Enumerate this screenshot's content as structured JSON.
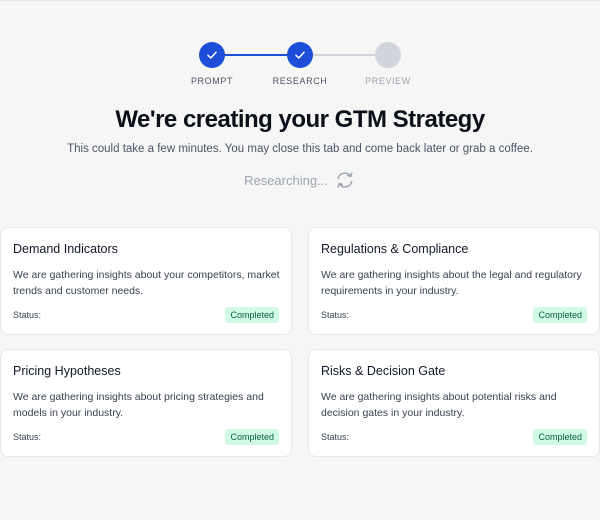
{
  "stepper": {
    "steps": [
      {
        "label": "PROMPT",
        "state": "completed"
      },
      {
        "label": "RESEARCH",
        "state": "completed"
      },
      {
        "label": "PREVIEW",
        "state": "pending"
      }
    ]
  },
  "header": {
    "title": "We're creating your GTM Strategy",
    "subtitle": "This could take a few minutes. You may close this tab and come back later or grab a coffee.",
    "status_text": "Researching...",
    "status_icon": "refresh-icon"
  },
  "cards": [
    {
      "title": "Demand Indicators",
      "description": "We are gathering insights about your competitors, market trends and customer needs.",
      "status_label": "Status:",
      "status_badge": "Completed"
    },
    {
      "title": "Regulations & Compliance",
      "description": "We are gathering insights about the legal and regulatory requirements in your industry.",
      "status_label": "Status:",
      "status_badge": "Completed"
    },
    {
      "title": "Pricing Hypotheses",
      "description": "We are gathering insights about pricing strategies and models in your industry.",
      "status_label": "Status:",
      "status_badge": "Completed"
    },
    {
      "title": "Risks & Decision Gate",
      "description": "We are gathering insights about potential risks and decision gates in your industry.",
      "status_label": "Status:",
      "status_badge": "Completed"
    }
  ],
  "colors": {
    "accent": "#1d4ed8",
    "pending": "#d1d5db",
    "badge_bg": "#d1fae5",
    "badge_text": "#065f46",
    "page_bg": "#f6f6f7"
  }
}
